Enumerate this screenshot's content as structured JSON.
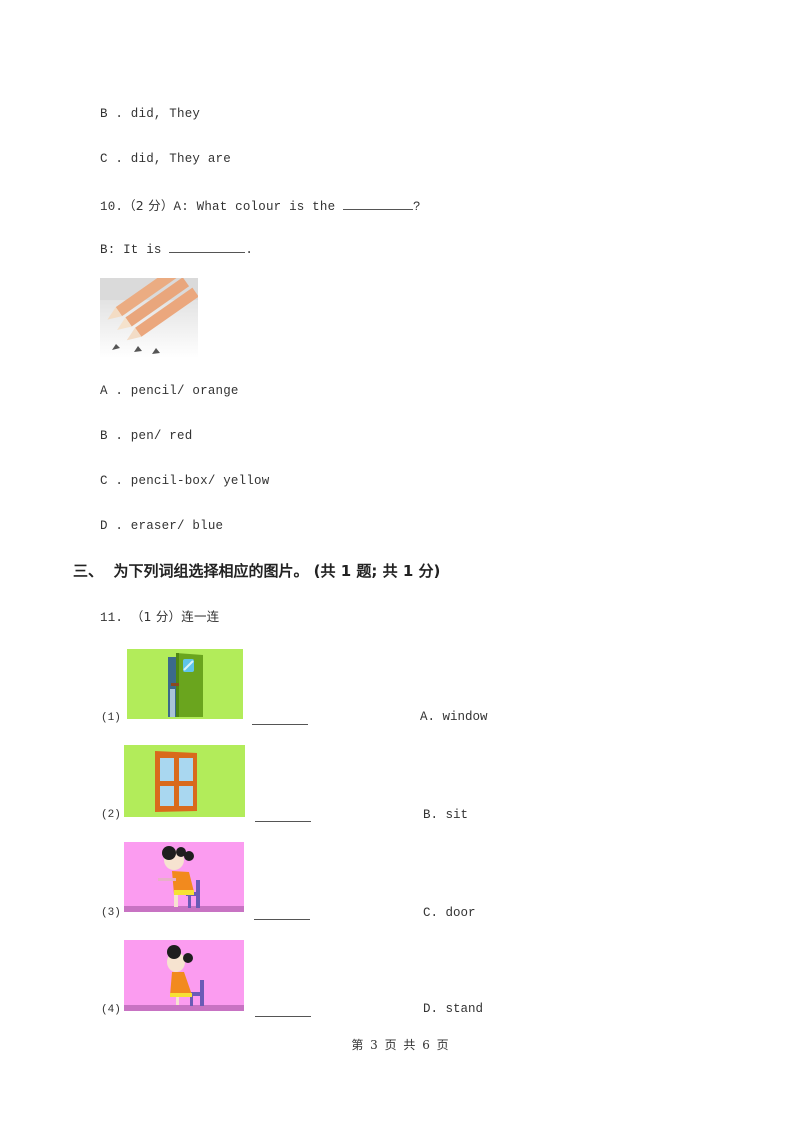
{
  "q9_options": [
    {
      "letter": "B",
      "text": "B . did, They"
    },
    {
      "letter": "C",
      "text": "C . did, They are"
    }
  ],
  "q10": {
    "number": "10.",
    "points": "（2 分）",
    "prompt_a": "A: What colour is the ",
    "prompt_a_end": "?",
    "prompt_b": "B: It is ",
    "prompt_b_end": ".",
    "image": "pencils-image",
    "options": [
      "A . pencil/ orange",
      "B . pen/ red",
      "C . pencil-box/ yellow",
      "D . eraser/ blue"
    ]
  },
  "section3": {
    "heading": "三、  为下列词组选择相应的图片。 (共 1 题; 共 1 分)"
  },
  "q11": {
    "number": "11.",
    "points": "（1 分）",
    "instruction": "连一连",
    "items": [
      {
        "label": "(1)",
        "image": "door-image",
        "option": "A. window"
      },
      {
        "label": "(2)",
        "image": "window-image",
        "option": "B. sit"
      },
      {
        "label": "(3)",
        "image": "girl-sitting-image",
        "option": "C. door"
      },
      {
        "label": "(4)",
        "image": "girl-standing-image",
        "option": "D. stand"
      }
    ]
  },
  "footer": {
    "page_text": "第 3 页 共 6 页"
  },
  "colors": {
    "green_bg": "#b2ec5a",
    "pink_bg": "#fb9cf0",
    "orange": "#e8a070"
  }
}
